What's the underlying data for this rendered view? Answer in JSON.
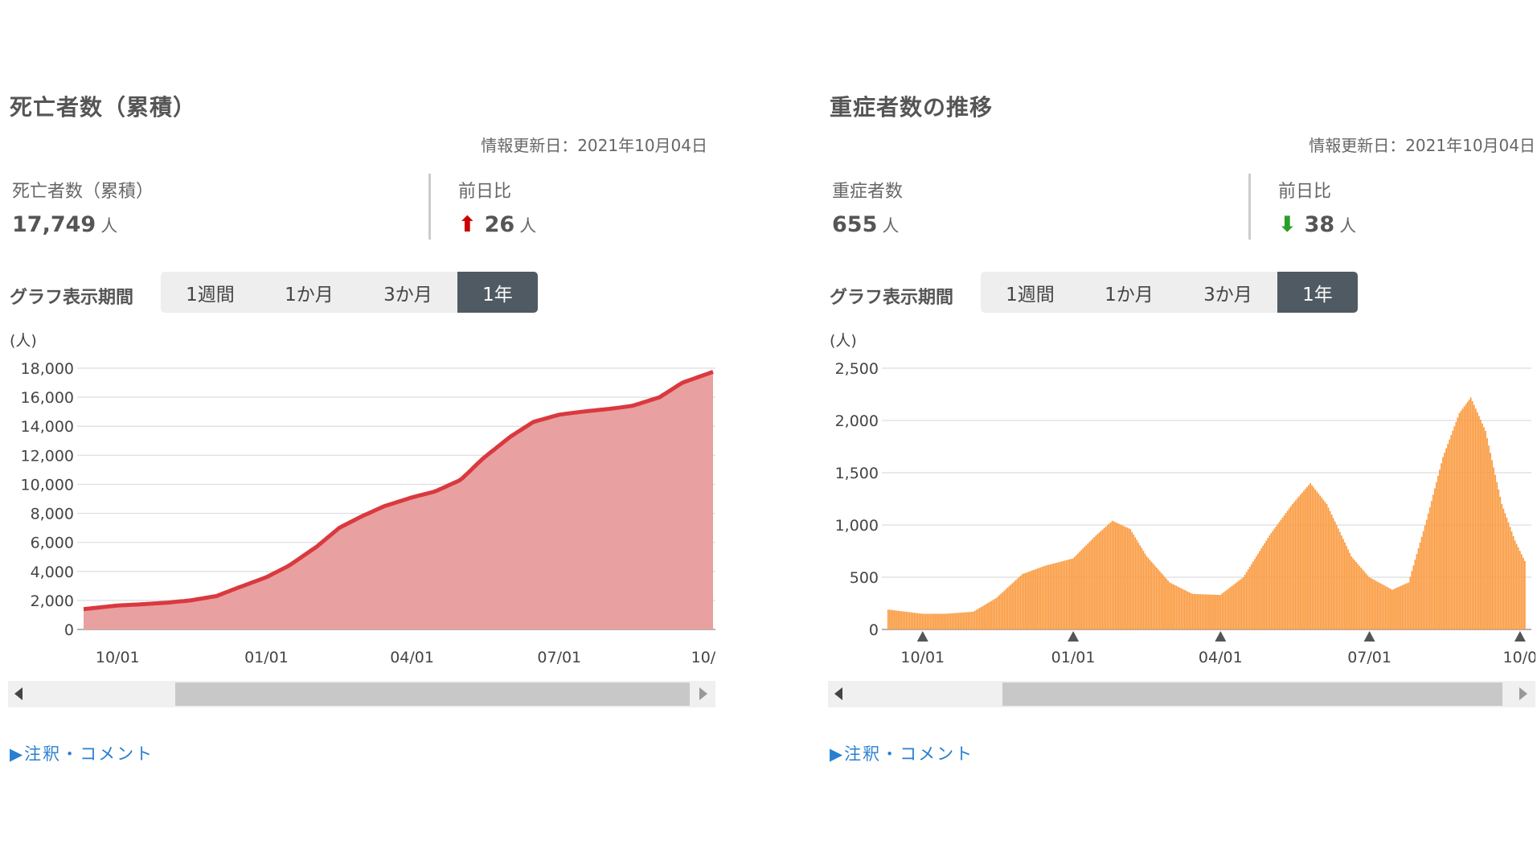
{
  "left": {
    "title": "死亡者数（累積）",
    "updated": "情報更新日：2021年10月04日",
    "stat_label": "死亡者数（累積）",
    "stat_value": "17,749",
    "stat_unit": "人",
    "diff_label": "前日比",
    "diff_arrow": "⬆",
    "diff_value": "26",
    "diff_unit": "人",
    "range_label": "グラフ表示期間",
    "range_buttons": [
      "1週間",
      "1か月",
      "3か月",
      "1年"
    ],
    "active_range": "1年",
    "comment": "▶注釈・コメント",
    "colors": {
      "line": "#d9393f",
      "fill": "#e8a0a0",
      "arrow": "#cc0000"
    }
  },
  "right": {
    "title": "重症者数の推移",
    "updated": "情報更新日：2021年10月04日",
    "stat_label": "重症者数",
    "stat_value": "655",
    "stat_unit": "人",
    "diff_label": "前日比",
    "diff_arrow": "⬇",
    "diff_value": "38",
    "diff_unit": "人",
    "range_label": "グラフ表示期間",
    "range_buttons": [
      "1週間",
      "1か月",
      "3か月",
      "1年"
    ],
    "active_range": "1年",
    "comment": "▶注釈・コメント",
    "colors": {
      "bar": "#fa9a3f",
      "arrow": "#2a9d2a"
    }
  },
  "chart_data": [
    {
      "type": "area",
      "unit_label": "(人)",
      "ylim": [
        0,
        18000
      ],
      "yticks": [
        "0",
        "2,000",
        "4,000",
        "6,000",
        "8,000",
        "10,000",
        "12,000",
        "14,000",
        "16,000",
        "18,000"
      ],
      "xticks": [
        "10/01",
        "01/01",
        "04/01",
        "07/01",
        "10/0"
      ],
      "x_start": "2020-09-10",
      "x_end": "2021-10-04",
      "series": [
        {
          "points": [
            [
              "2020-09-10",
              1400
            ],
            [
              "2020-10-01",
              1650
            ],
            [
              "2020-10-15",
              1730
            ],
            [
              "2020-11-01",
              1850
            ],
            [
              "2020-11-15",
              2000
            ],
            [
              "2020-12-01",
              2300
            ],
            [
              "2020-12-15",
              2900
            ],
            [
              "2021-01-01",
              3600
            ],
            [
              "2021-01-15",
              4400
            ],
            [
              "2021-02-01",
              5700
            ],
            [
              "2021-02-15",
              7000
            ],
            [
              "2021-03-01",
              7800
            ],
            [
              "2021-03-15",
              8500
            ],
            [
              "2021-04-01",
              9100
            ],
            [
              "2021-04-15",
              9500
            ],
            [
              "2021-05-01",
              10300
            ],
            [
              "2021-05-15",
              11800
            ],
            [
              "2021-06-01",
              13300
            ],
            [
              "2021-06-15",
              14300
            ],
            [
              "2021-07-01",
              14800
            ],
            [
              "2021-07-15",
              15000
            ],
            [
              "2021-08-01",
              15200
            ],
            [
              "2021-08-15",
              15400
            ],
            [
              "2021-09-01",
              16000
            ],
            [
              "2021-09-15",
              17000
            ],
            [
              "2021-10-04",
              17749
            ]
          ]
        }
      ]
    },
    {
      "type": "bar",
      "unit_label": "(人)",
      "ylim": [
        0,
        2500
      ],
      "yticks": [
        "0",
        "500",
        "1,000",
        "1,500",
        "2,000",
        "2,500"
      ],
      "xticks": [
        "10/01",
        "01/01",
        "04/01",
        "07/01",
        "10/0"
      ],
      "x_start": "2020-09-10",
      "x_end": "2021-10-04",
      "series": [
        {
          "points": [
            [
              "2020-09-10",
              190
            ],
            [
              "2020-10-01",
              150
            ],
            [
              "2020-10-15",
              150
            ],
            [
              "2020-11-01",
              170
            ],
            [
              "2020-11-15",
              300
            ],
            [
              "2020-12-01",
              530
            ],
            [
              "2020-12-15",
              610
            ],
            [
              "2021-01-01",
              680
            ],
            [
              "2021-01-15",
              900
            ],
            [
              "2021-01-25",
              1040
            ],
            [
              "2021-02-05",
              960
            ],
            [
              "2021-02-15",
              700
            ],
            [
              "2021-03-01",
              450
            ],
            [
              "2021-03-15",
              340
            ],
            [
              "2021-04-01",
              330
            ],
            [
              "2021-04-15",
              500
            ],
            [
              "2021-05-01",
              900
            ],
            [
              "2021-05-15",
              1200
            ],
            [
              "2021-05-26",
              1400
            ],
            [
              "2021-06-05",
              1200
            ],
            [
              "2021-06-20",
              700
            ],
            [
              "2021-07-01",
              500
            ],
            [
              "2021-07-15",
              380
            ],
            [
              "2021-07-25",
              450
            ],
            [
              "2021-08-05",
              1050
            ],
            [
              "2021-08-15",
              1650
            ],
            [
              "2021-08-25",
              2070
            ],
            [
              "2021-09-01",
              2220
            ],
            [
              "2021-09-10",
              1900
            ],
            [
              "2021-09-20",
              1200
            ],
            [
              "2021-09-28",
              850
            ],
            [
              "2021-10-04",
              655
            ]
          ]
        }
      ]
    }
  ]
}
